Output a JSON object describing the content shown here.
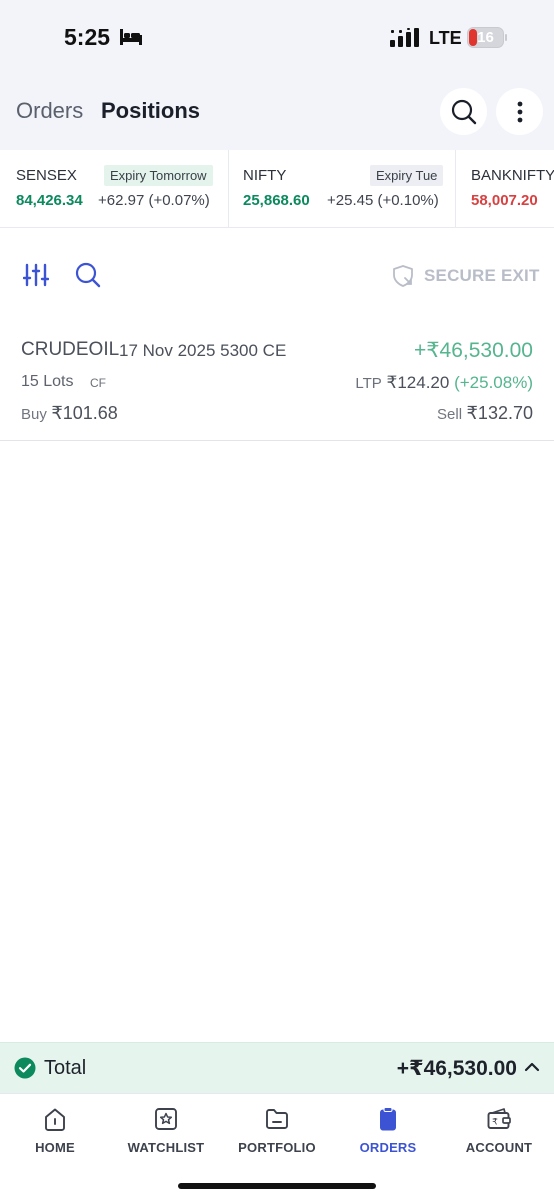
{
  "status_bar": {
    "time": "5:25",
    "network": "LTE",
    "battery": "16"
  },
  "header": {
    "tabs": [
      {
        "label": "Orders",
        "active": false
      },
      {
        "label": "Positions",
        "active": true
      }
    ]
  },
  "indices": [
    {
      "name": "SENSEX",
      "badge": "Expiry Tomorrow",
      "value": "84,426.34",
      "change": "+62.97 (+0.07%)",
      "value_color": "#0c8a5e"
    },
    {
      "name": "NIFTY",
      "badge": "Expiry Tue",
      "value": "25,868.60",
      "change": "+25.45 (+0.10%)",
      "value_color": "#0c8a5e"
    },
    {
      "name": "BANKNIFTY",
      "badge": "",
      "value": "58,007.20",
      "change": "",
      "value_color": "#d84141"
    }
  ],
  "toolbar": {
    "secure_exit_label": "SECURE EXIT"
  },
  "positions": [
    {
      "symbol": "CRUDEOIL",
      "contract": "17 Nov 2025 5300 CE",
      "pnl": "+₹46,530.00",
      "lots": "15 Lots",
      "tag": "CF",
      "ltp_label": "LTP",
      "ltp": "₹124.20",
      "ltp_change": "(+25.08%)",
      "buy_label": "Buy",
      "buy_price": "₹101.68",
      "sell_label": "Sell",
      "sell_price": "₹132.70"
    }
  ],
  "total": {
    "label": "Total",
    "value": "+₹46,530.00"
  },
  "bottom_nav": [
    {
      "label": "HOME",
      "icon": "home-icon",
      "active": false
    },
    {
      "label": "WATCHLIST",
      "icon": "star-icon",
      "active": false
    },
    {
      "label": "PORTFOLIO",
      "icon": "folder-icon",
      "active": false
    },
    {
      "label": "ORDERS",
      "icon": "clipboard-icon",
      "active": true
    },
    {
      "label": "ACCOUNT",
      "icon": "wallet-icon",
      "active": false
    }
  ],
  "colors": {
    "accent": "#3c54d4",
    "profit": "#55b58f",
    "positive": "#0c8a5e",
    "negative": "#d84141",
    "total_bar": "#e6f4ee"
  }
}
